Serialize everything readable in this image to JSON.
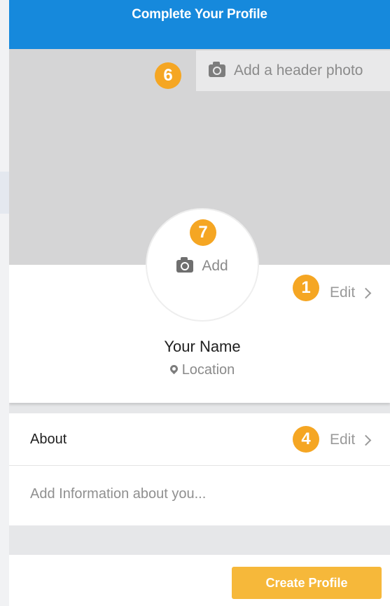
{
  "header": {
    "title": "Complete Your Profile"
  },
  "cover": {
    "add_header_photo_label": "Add a header photo",
    "badge": "6"
  },
  "avatar": {
    "add_label": "Add",
    "badge": "7"
  },
  "profile": {
    "name": "Your Name",
    "location": "Location",
    "edit_label": "Edit",
    "edit_badge": "1"
  },
  "about": {
    "title": "About",
    "edit_label": "Edit",
    "edit_badge": "4",
    "placeholder": "Add Information about you..."
  },
  "footer": {
    "create_profile_label": "Create Profile"
  },
  "colors": {
    "header_blue": "#1689dc",
    "badge_orange": "#f5a623",
    "button_orange": "#f6b83a"
  },
  "icons": {
    "camera": "camera-icon",
    "pin": "map-pin-icon",
    "chevron": "chevron-right-icon"
  }
}
